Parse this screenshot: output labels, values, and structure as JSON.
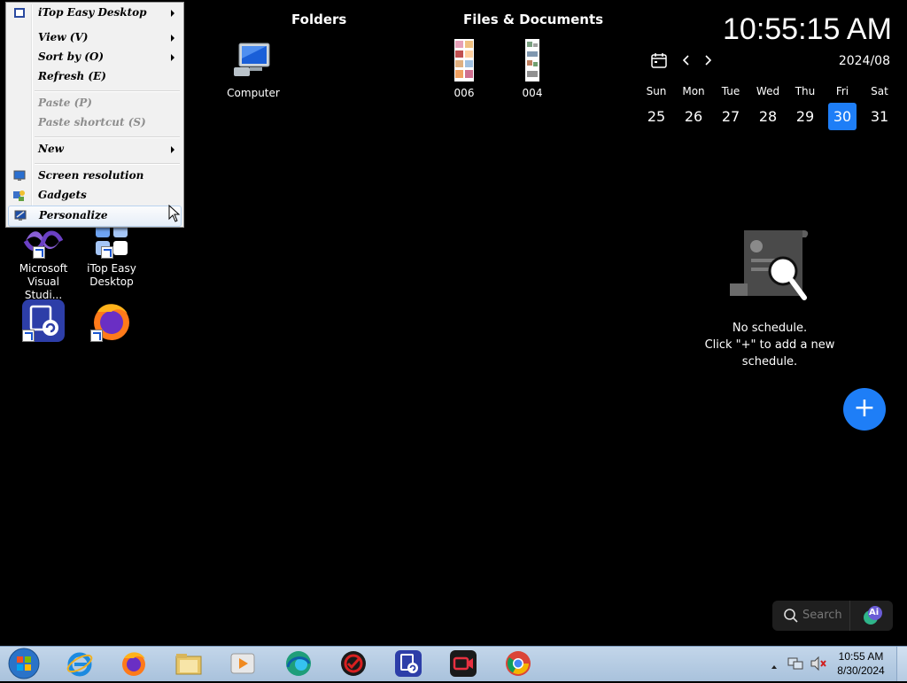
{
  "sections": {
    "folders_title": "Folders",
    "files_title": "Files & Documents"
  },
  "desktop_icons": {
    "computer": "Computer",
    "file_006": "006",
    "file_004": "004",
    "vs": "Microsoft Visual Studi...",
    "itop": "iTop Easy Desktop"
  },
  "context_menu": {
    "items": [
      {
        "label": "iTop Easy Desktop",
        "icon": "itop-icon",
        "submenu": true,
        "disabled": false
      },
      {
        "label": "View (V)",
        "submenu": true,
        "disabled": false
      },
      {
        "label": "Sort by (O)",
        "submenu": true,
        "disabled": false
      },
      {
        "label": "Refresh (E)",
        "submenu": false,
        "disabled": false
      },
      {
        "label": "Paste (P)",
        "submenu": false,
        "disabled": true
      },
      {
        "label": "Paste shortcut (S)",
        "submenu": false,
        "disabled": true
      },
      {
        "label": "New",
        "submenu": true,
        "disabled": false
      },
      {
        "label": "Screen resolution",
        "icon": "screen-resolution-icon",
        "submenu": false,
        "disabled": false
      },
      {
        "label": "Gadgets",
        "icon": "gadgets-icon",
        "submenu": false,
        "disabled": false
      },
      {
        "label": "Personalize",
        "icon": "personalize-icon",
        "submenu": false,
        "disabled": false
      }
    ]
  },
  "clock": {
    "time": "10:55:15 AM"
  },
  "calendar": {
    "month": "2024/08",
    "days": [
      "Sun",
      "Mon",
      "Tue",
      "Wed",
      "Thu",
      "Fri",
      "Sat"
    ],
    "dates": [
      "25",
      "26",
      "27",
      "28",
      "29",
      "30",
      "31"
    ],
    "today": "30",
    "accent": "#1e7ef7"
  },
  "schedule": {
    "empty_line1": "No schedule.",
    "empty_line2": "Click \"+\" to add a new schedule.",
    "add_symbol": "+"
  },
  "search": {
    "placeholder": "Search",
    "ai_label": "Ai"
  },
  "taskbar": {
    "time": "10:55 AM",
    "date": "8/30/2024",
    "icons": [
      "start-orb-icon",
      "internet-explorer-icon",
      "firefox-icon",
      "file-explorer-icon",
      "media-player-icon",
      "edge-icon",
      "antivirus-icon",
      "itop-backup-icon",
      "screen-recorder-icon",
      "chrome-icon"
    ]
  }
}
